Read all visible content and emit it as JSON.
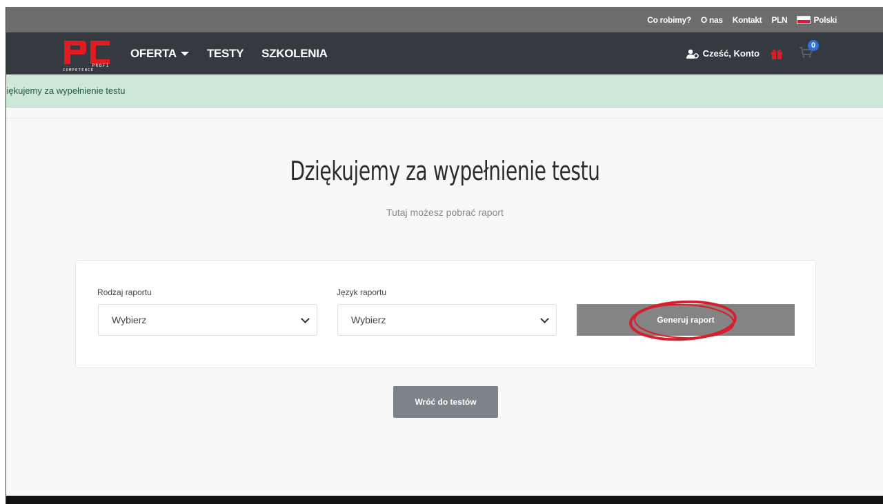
{
  "topbar": {
    "links": [
      "Co robimy?",
      "O nas",
      "Kontakt",
      "PLN"
    ],
    "language": "Polski"
  },
  "navbar": {
    "logo": {
      "main": "PC",
      "sub1": "PROFI",
      "sub2": "COMPETENCE"
    },
    "menu": {
      "offer": "OFERTA",
      "tests": "TESTY",
      "trainings": "SZKOLENIA"
    },
    "account": "Cześć, Konto",
    "cart_count": "0"
  },
  "alert": {
    "text": "ziękujemy za wypełnienie testu"
  },
  "main": {
    "title": "Dziękujemy za wypełnienie testu",
    "subtitle": "Tutaj możesz pobrać raport"
  },
  "form": {
    "report_type_label": "Rodzaj raportu",
    "report_type_value": "Wybierz",
    "report_lang_label": "Język raportu",
    "report_lang_value": "Wybierz",
    "generate_label": "Generuj raport"
  },
  "back_button": "Wróć do testów",
  "colors": {
    "navbar": "#343a40",
    "topbar": "#6d6d6d",
    "logo_red": "#e11b22",
    "alert_bg": "#cde8d6",
    "annotation_red": "#d81e2b"
  }
}
